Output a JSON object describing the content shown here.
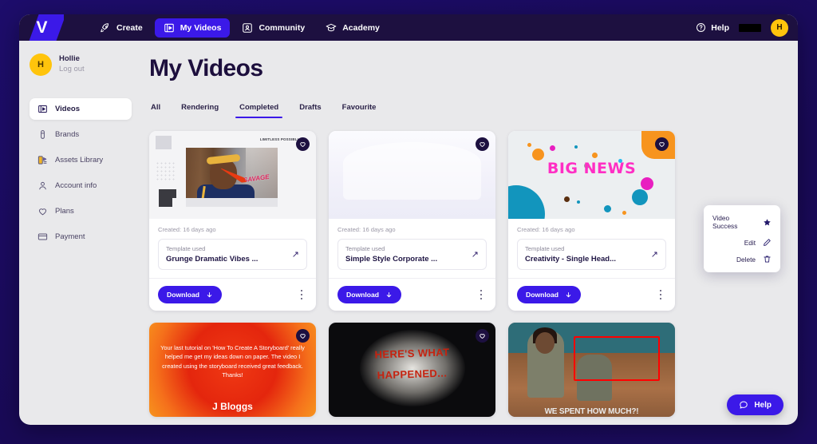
{
  "topnav": {
    "logo": "V",
    "items": [
      {
        "label": "Create",
        "icon": "rocket-icon",
        "active": false
      },
      {
        "label": "My Videos",
        "icon": "video-box-icon",
        "active": true
      },
      {
        "label": "Community",
        "icon": "community-icon",
        "active": false
      },
      {
        "label": "Academy",
        "icon": "graduation-cap-icon",
        "active": false
      }
    ],
    "help_label": "Help",
    "redacted": "",
    "avatar_initial": "H"
  },
  "sidebar": {
    "profile": {
      "initial": "H",
      "name": "Hollie",
      "logout_label": "Log out"
    },
    "items": [
      {
        "label": "Videos",
        "icon": "video-box-icon",
        "active": true
      },
      {
        "label": "Brands",
        "icon": "brand-icon",
        "active": false
      },
      {
        "label": "Assets Library",
        "icon": "assets-library-icon",
        "active": false
      },
      {
        "label": "Account info",
        "icon": "user-icon",
        "active": false
      },
      {
        "label": "Plans",
        "icon": "heart-icon",
        "active": false
      },
      {
        "label": "Payment",
        "icon": "card-icon",
        "active": false
      }
    ]
  },
  "main": {
    "title": "My Videos",
    "tabs": [
      {
        "label": "All",
        "active": false
      },
      {
        "label": "Rendering",
        "active": false
      },
      {
        "label": "Completed",
        "active": true
      },
      {
        "label": "Drafts",
        "active": false
      },
      {
        "label": "Favourite",
        "active": false
      }
    ],
    "cards": [
      {
        "created": "Created: 16 days ago",
        "template_label": "Template used",
        "template_name": "Grunge Dramatic Vibes ...",
        "download_label": "Download",
        "favourited": false,
        "thumb_text": "LIMITLESS POSSIBLI",
        "thumb_accent": "SAVAGE"
      },
      {
        "created": "Created: 16 days ago",
        "template_label": "Template used",
        "template_name": "Simple Style Corporate ...",
        "download_label": "Download",
        "favourited": false
      },
      {
        "created": "Created: 16 days ago",
        "template_label": "Template used",
        "template_name": "Creativity - Single Head...",
        "download_label": "Download",
        "favourited": true,
        "thumb_text": "BIG NEWS"
      }
    ],
    "bottom_cards": [
      {
        "quote": "Your last tutorial on 'How To Create A Storyboard' really helped me get my ideas down on paper. The video I created using the storyboard received great feedback. Thanks!",
        "author": "J Bloggs"
      },
      {
        "line1": "HERE'S WHAT",
        "line2": "HAPPENED..."
      },
      {
        "caption": "WE SPENT HOW MUCH?!"
      }
    ],
    "context_menu": {
      "title": "Video Success",
      "title_icon": "star-icon",
      "items": [
        {
          "label": "Edit",
          "icon": "pencil-icon"
        },
        {
          "label": "Delete",
          "icon": "trash-icon"
        }
      ]
    }
  },
  "help_widget": {
    "label": "Help",
    "icon": "chat-bubble-icon"
  },
  "colors": {
    "brand_purple": "#3b19e8",
    "nav_dark": "#1d1040",
    "accent_yellow": "#ffc40c",
    "accent_orange": "#f7941e",
    "highlight_red": "#ff0000",
    "page_bg": "#e9e9eb"
  }
}
